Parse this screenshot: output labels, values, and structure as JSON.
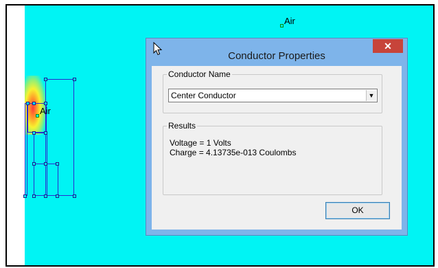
{
  "canvas": {
    "background_color": "#00f4f4",
    "region_labels": [
      "Air",
      "Air"
    ]
  },
  "dialog": {
    "title": "Conductor Properties",
    "close_symbol": "✕",
    "conductor_name_group": {
      "label": "Conductor Name",
      "selected": "Center Conductor",
      "dropdown_icon": "chevron-down-icon"
    },
    "results_group": {
      "label": "Results",
      "lines": [
        "Voltage = 1 Volts",
        "Charge = 4.13735e-013 Coulombs"
      ]
    },
    "ok_label": "OK"
  },
  "colors": {
    "dialog_frame": "#7eb4ea",
    "close_button": "#c7443a",
    "structure_outline": "#2a2ad0"
  }
}
